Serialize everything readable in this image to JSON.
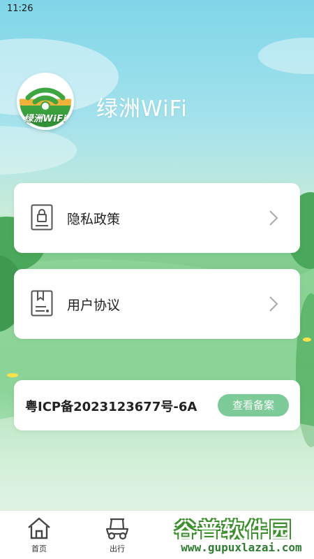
{
  "status_bar": {
    "time": "11:26"
  },
  "brand": {
    "logo_text": "绿洲WiFi",
    "app_name": "绿洲WiFi"
  },
  "menu": [
    {
      "label": "隐私政策",
      "icon": "lock-document-icon"
    },
    {
      "label": "用户协议",
      "icon": "bookmark-document-icon"
    }
  ],
  "icp": {
    "text": "粤ICP备2023123677号-6A",
    "button_label": "查看备案"
  },
  "tabbar": {
    "tabs": [
      {
        "label": "首页",
        "icon": "home-icon"
      },
      {
        "label": "出行",
        "icon": "golf-cart-icon"
      }
    ]
  },
  "watermark": {
    "title": "谷普软件园",
    "url": "www.gupuxlazai.com"
  },
  "colors": {
    "accent": "#7ccb98",
    "card_bg": "#ffffff",
    "text": "#222222"
  }
}
